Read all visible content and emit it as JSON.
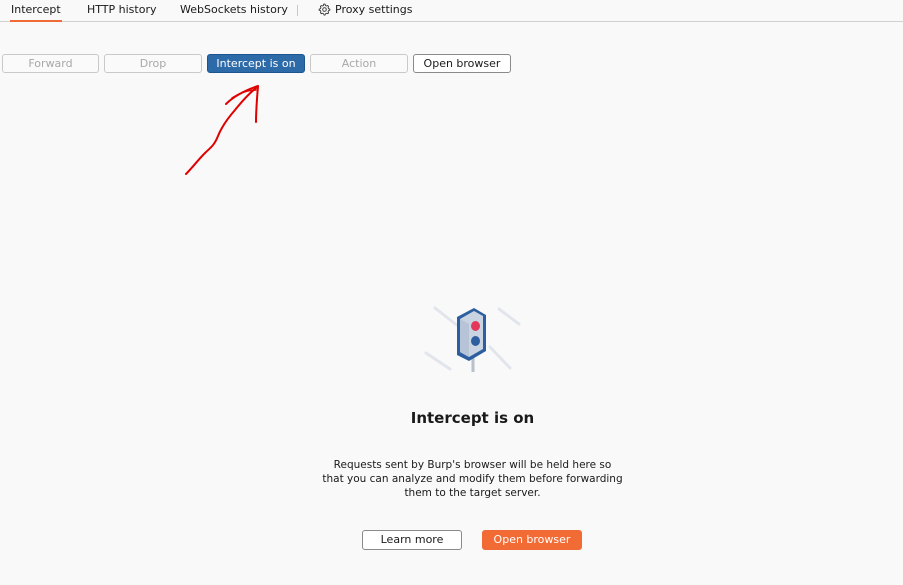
{
  "tabs": [
    {
      "label": "Intercept",
      "active": true
    },
    {
      "label": "HTTP history",
      "active": false
    },
    {
      "label": "WebSockets history",
      "active": false
    }
  ],
  "proxy_settings": {
    "label": "Proxy settings",
    "icon": "gear-icon"
  },
  "toolbar": {
    "forward": "Forward",
    "drop": "Drop",
    "intercept": "Intercept is on",
    "action": "Action",
    "open_browser": "Open browser"
  },
  "empty_state": {
    "icon": "traffic-light-icon",
    "title": "Intercept is on",
    "description": "Requests sent by Burp's browser will be held here so that you can analyze and modify them before forwarding them to the target server.",
    "learn_more": "Learn more",
    "open_browser": "Open browser"
  },
  "colors": {
    "accent": "#f06a35",
    "intercept_button": "#2d6aa8",
    "annotation": "#e00000"
  }
}
